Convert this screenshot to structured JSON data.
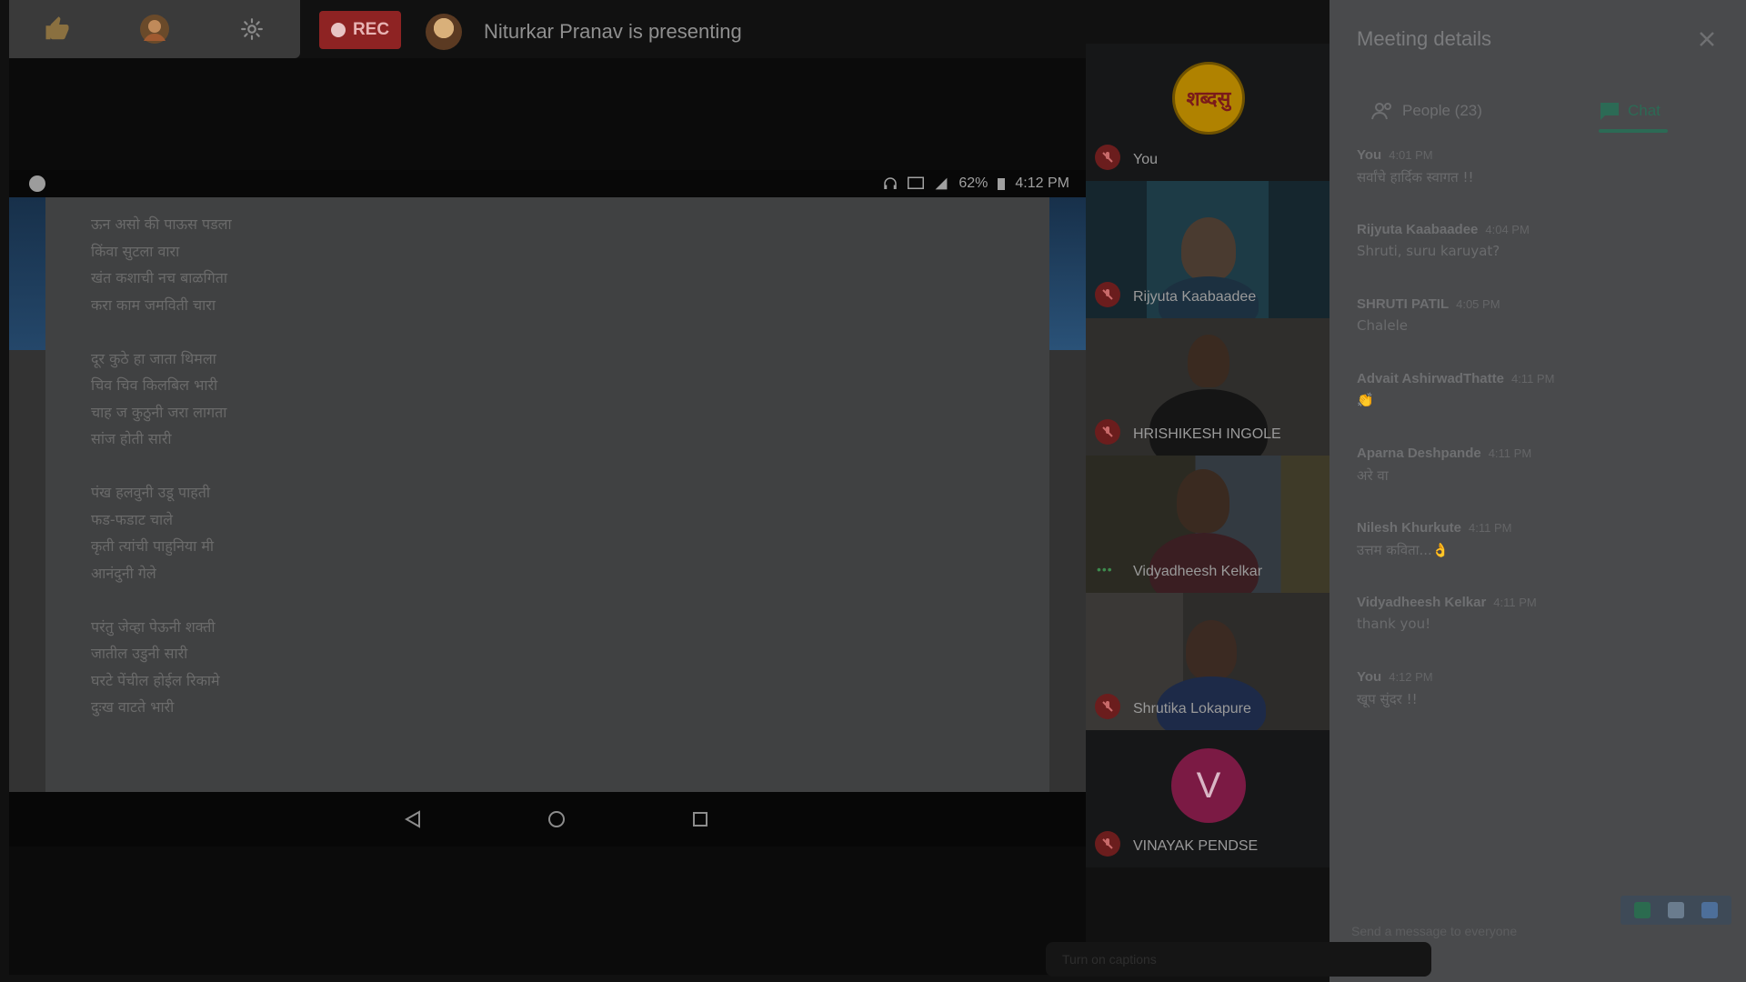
{
  "topbar": {
    "rec_label": "REC",
    "presenter_text": "Niturkar Pranav is presenting",
    "icons": [
      "thumbs-up-icon",
      "avatar-icon",
      "gear-icon"
    ]
  },
  "phone_status": {
    "battery": "62%",
    "time": "4:12 PM"
  },
  "poem": {
    "stanzas": [
      [
        "ऊन असो की पाऊस पडला",
        "किंवा सुटला वारा",
        "खंत कशाची नच बाळगिता",
        "करा काम जमविती चारा"
      ],
      [
        "दूर कुठे हा जाता थिमला",
        "चिव चिव किलबिल भारी",
        "चाह ज कुठुनी जरा लागता",
        "सांज होती सारी"
      ],
      [
        "पंख हलवुनी उडू पाहती",
        "फड-फडाट चाले",
        "कृती त्यांची पाहुनिया मी",
        "आनंदुनी गेले"
      ],
      [
        "परंतु जेव्हा पेऊनी शक्ती",
        "जातील उडुनी सारी",
        "घरटे पेंचील होईल रिकामे",
        "दुःख वाटते भारी"
      ]
    ]
  },
  "participants": [
    {
      "name": "You",
      "avatar_text": "शब्दसु"
    },
    {
      "name": "Rijyuta Kaabaadee"
    },
    {
      "name": "HRISHIKESH INGOLE"
    },
    {
      "name": "Vidyadheesh Kelkar"
    },
    {
      "name": "Shrutika Lokapure"
    },
    {
      "name": "VINAYAK PENDSE",
      "initial": "V"
    }
  ],
  "panel": {
    "title": "Meeting details",
    "tab_people": "People (23)",
    "tab_chat": "Chat",
    "input_placeholder": "Send a message to everyone"
  },
  "chat": [
    {
      "sender": "You",
      "time": "4:01 PM",
      "text": "सर्वांचे हार्दिक स्वागत !!"
    },
    {
      "sender": "Rijyuta Kaabaadee",
      "time": "4:04 PM",
      "text": "Shruti, suru karuyat?"
    },
    {
      "sender": "SHRUTI PATIL",
      "time": "4:05 PM",
      "text": "Chalele"
    },
    {
      "sender": "Advait AshirwadThatte",
      "time": "4:11 PM",
      "text": "👏"
    },
    {
      "sender": "Aparna Deshpande",
      "time": "4:11 PM",
      "text": "अरे वा"
    },
    {
      "sender": "Nilesh Khurkute",
      "time": "4:11 PM",
      "text": "उत्तम कविता...👌"
    },
    {
      "sender": "Vidyadheesh Kelkar",
      "time": "4:11 PM",
      "text": "thank you!"
    },
    {
      "sender": "You",
      "time": "4:12 PM",
      "text": "खूप सुंदर !!"
    }
  ],
  "captions": {
    "label": "Turn on captions"
  }
}
